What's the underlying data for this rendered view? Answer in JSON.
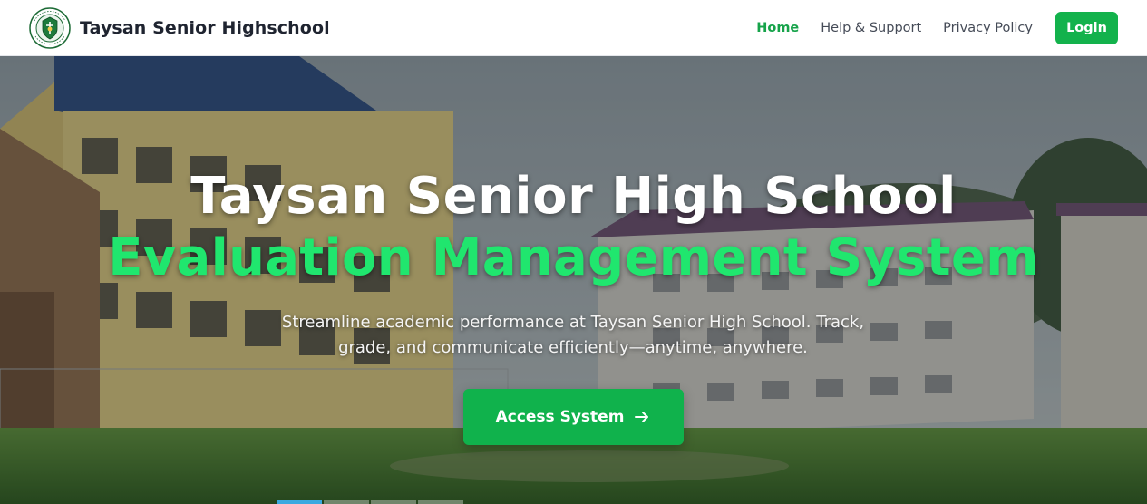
{
  "navbar": {
    "logo": {
      "icon": "school-seal-logo",
      "seal_text_top": "TAYSAN · SENIOR",
      "seal_text_bottom": "HIGH SCHOOL"
    },
    "brand_name": "Taysan Senior Highschool",
    "links": [
      {
        "label": "Home",
        "active": true
      },
      {
        "label": "Help & Support",
        "active": false
      },
      {
        "label": "Privacy Policy",
        "active": false
      }
    ],
    "login_label": "Login"
  },
  "hero": {
    "background": "school-campus-photo",
    "title_line1": "Taysan Senior High School",
    "title_line2": "Evaluation Management System",
    "subtitle_line1": "Streamline academic performance at Taysan Senior High School. Track,",
    "subtitle_line2": "grade, and communicate efficiently—anytime, anywhere.",
    "cta_label": "Access System",
    "cta_icon": "arrow-right-icon",
    "slide_indicators": [
      true,
      false,
      false,
      false
    ]
  },
  "colors": {
    "accent_green": "#13b24c",
    "highlight_green": "#20e66e",
    "active_link": "#16a34a",
    "active_indicator": "#3aa9e0"
  }
}
